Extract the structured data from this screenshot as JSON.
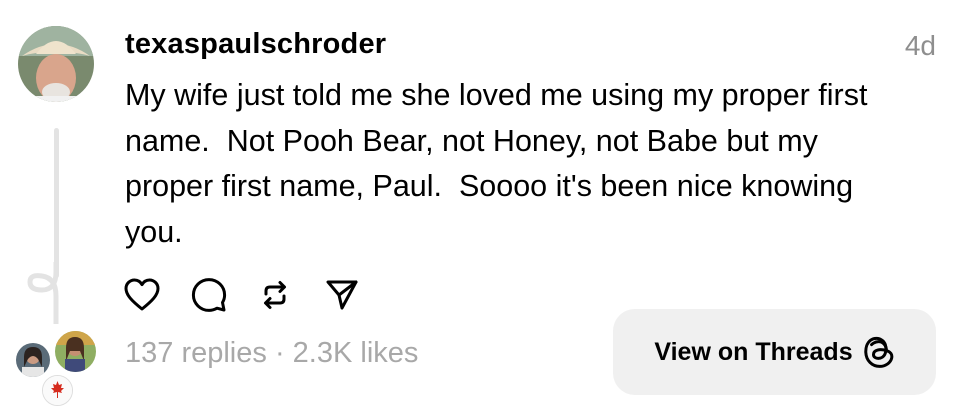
{
  "post": {
    "username": "texaspaulschroder",
    "time_ago": "4d",
    "text": "My wife just told me she loved me using my proper first\nname.  Not Pooh Bear, not Honey, not Babe but my\nproper first name, Paul.  Soooo it's been nice knowing\nyou."
  },
  "actions": {
    "icons": [
      "heart-icon",
      "comment-icon",
      "repost-icon",
      "share-icon"
    ]
  },
  "stats": {
    "replies": "137 replies",
    "separator": "·",
    "likes": "2.3K likes"
  },
  "view_button": {
    "label": "View on Threads",
    "icon": "threads-logo-icon"
  },
  "colors": {
    "secondary_text": "#a8a8a8",
    "time_text": "#8e8e8e",
    "button_bg": "#f0f0f0",
    "thread_line": "#e3e3e3"
  }
}
